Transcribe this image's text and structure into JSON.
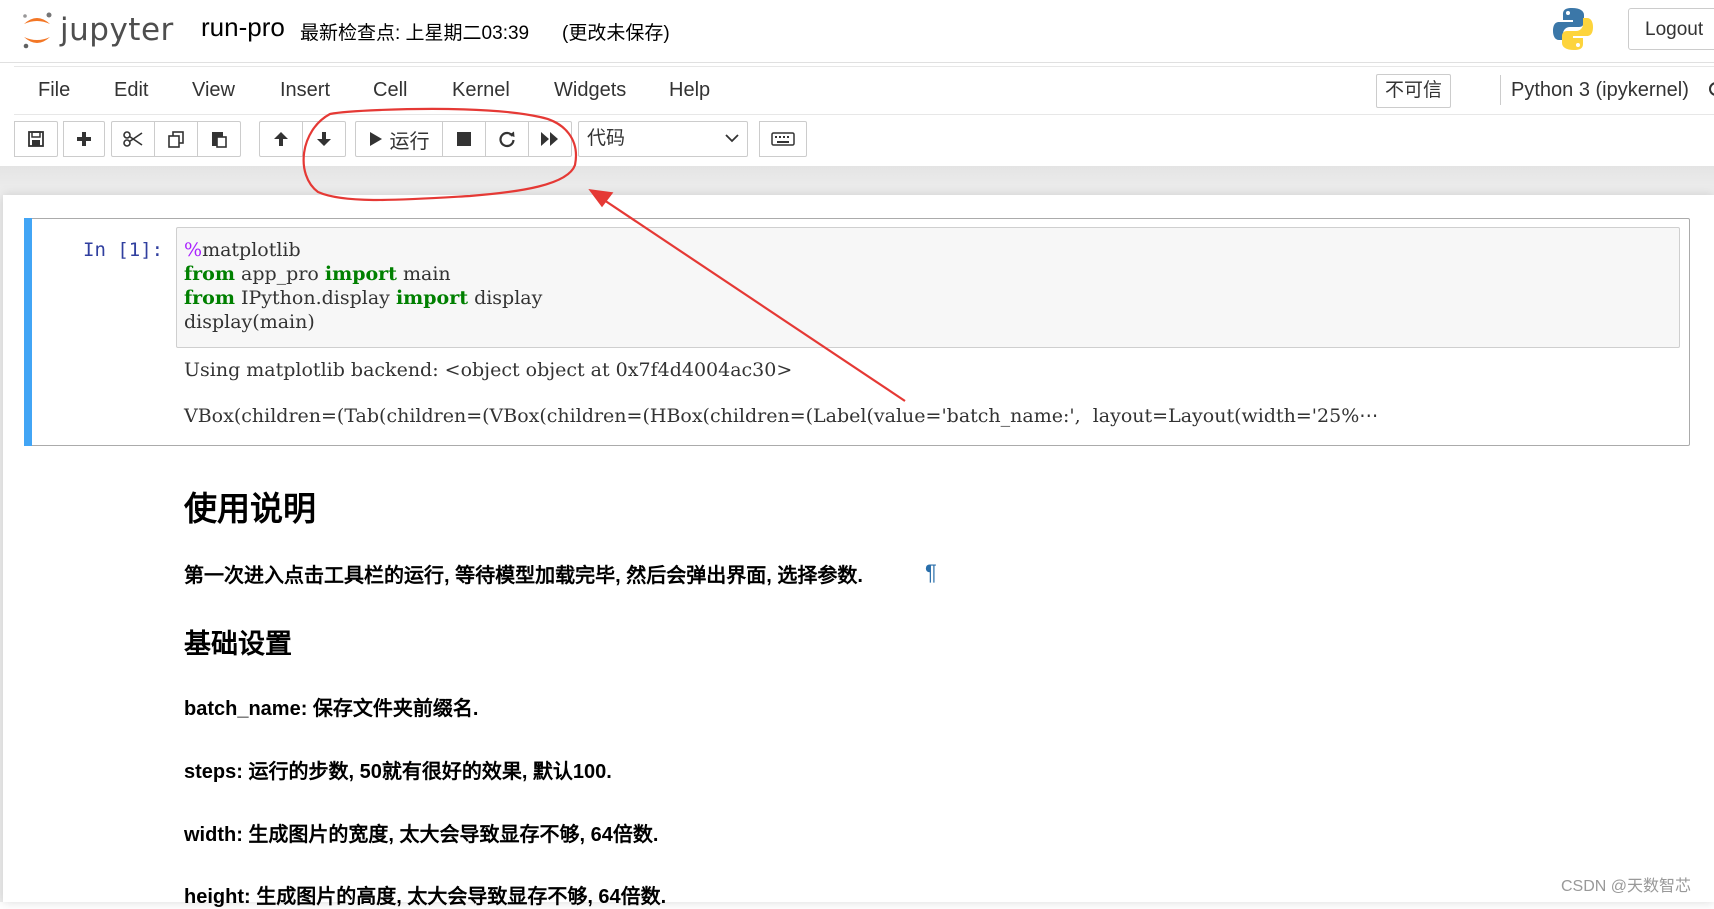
{
  "header": {
    "brand": "jupyter",
    "notebook_name": "run-pro",
    "checkpoint": "最新检查点: 上星期二03:39",
    "autosave_status": "(更改未保存)",
    "logout_label": "Logout"
  },
  "menubar": {
    "items": [
      "File",
      "Edit",
      "View",
      "Insert",
      "Cell",
      "Kernel",
      "Widgets",
      "Help"
    ],
    "trust_label": "不可信",
    "kernel_name": "Python 3 (ipykernel)"
  },
  "toolbar": {
    "run_label": "运行",
    "cell_type": "代码",
    "buttons": [
      "save-icon",
      "plus-icon",
      "cut-icon",
      "copy-icon",
      "paste-icon",
      "arrow-up-icon",
      "arrow-down-icon",
      "run-icon",
      "stop-icon",
      "restart-icon",
      "fast-forward-icon",
      "keyboard-icon"
    ]
  },
  "cell1": {
    "prompt": "In  [1]:",
    "code": {
      "line1_magic": "%",
      "line1_rest": "matplotlib",
      "line2_kw1": "from",
      "line2_mod": " app_pro ",
      "line2_kw2": "import",
      "line2_name": " main",
      "line3_kw1": "from",
      "line3_mod": " IPython.display ",
      "line3_kw2": "import",
      "line3_name": " display",
      "line4": "display(main)"
    },
    "outputs": [
      "Using matplotlib backend: <object object at 0x7f4d4004ac30>",
      "VBox(children=(Tab(children=(VBox(children=(HBox(children=(Label(value='batch_name:',  layout=Layout(width='25%⋯"
    ]
  },
  "markdown": {
    "h1": "使用说明",
    "intro": "第一次进入点击工具栏的运行, 等待模型加载完毕, 然后会弹出界面, 选择参数.",
    "pilcrow": "¶",
    "h2": "基础设置",
    "p1": "batch_name: 保存文件夹前缀名.",
    "p2": "steps: 运行的步数, 50就有很好的效果, 默认100.",
    "p3": "width: 生成图片的宽度, 太大会导致显存不够, 64倍数.",
    "p4": "height: 生成图片的高度, 太大会导致显存不够, 64倍数."
  },
  "watermark": "CSDN @天数智芯",
  "colors": {
    "cell_selected_bar": "#42a5f5",
    "prompt_in": "#303f9f",
    "keyword": "#008000",
    "magic": "#aa22ff",
    "annotation": "#e53935"
  }
}
